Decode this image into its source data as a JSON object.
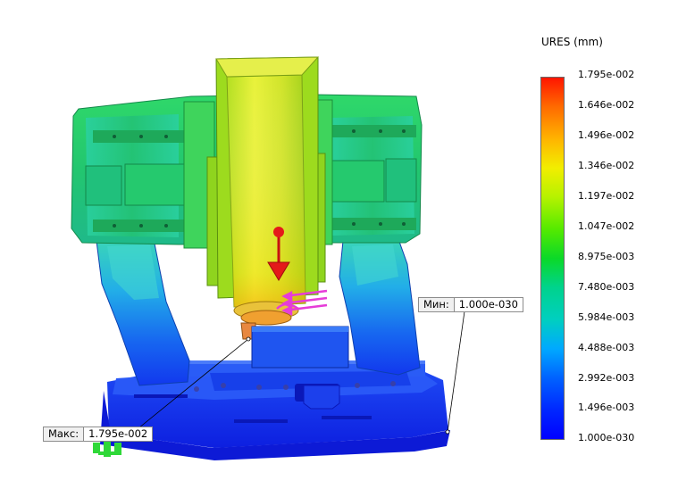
{
  "legend": {
    "title": "URES (mm)",
    "ticks": [
      "1.795e-002",
      "1.646e-002",
      "1.496e-002",
      "1.346e-002",
      "1.197e-002",
      "1.047e-002",
      "8.975e-003",
      "7.480e-003",
      "5.984e-003",
      "4.488e-003",
      "2.992e-003",
      "1.496e-003",
      "1.000e-030"
    ],
    "colors": [
      "#ff1500",
      "#ff6a00",
      "#ffb400",
      "#f2ee00",
      "#b6f200",
      "#54ea00",
      "#0bd928",
      "#00d38c",
      "#00cfc0",
      "#00a9ff",
      "#0063ff",
      "#0027ff",
      "#0000ff"
    ]
  },
  "probes": {
    "min": {
      "caption": "Мин:",
      "value": "1.000e-030"
    },
    "max": {
      "caption": "Макс:",
      "value": "1.795e-002"
    }
  },
  "colors": {
    "shell_green": "#27cd69",
    "rail_green": "#2fd86d",
    "spindle_yellow": "#d8ea2a",
    "base_blue": "#1432e8",
    "force_arrow": "#e41a1a",
    "fixture_magenta": "#e63cd8"
  },
  "icons": [
    "force-arrow-icon",
    "fixture-icon",
    "ground-fixture-icon"
  ]
}
